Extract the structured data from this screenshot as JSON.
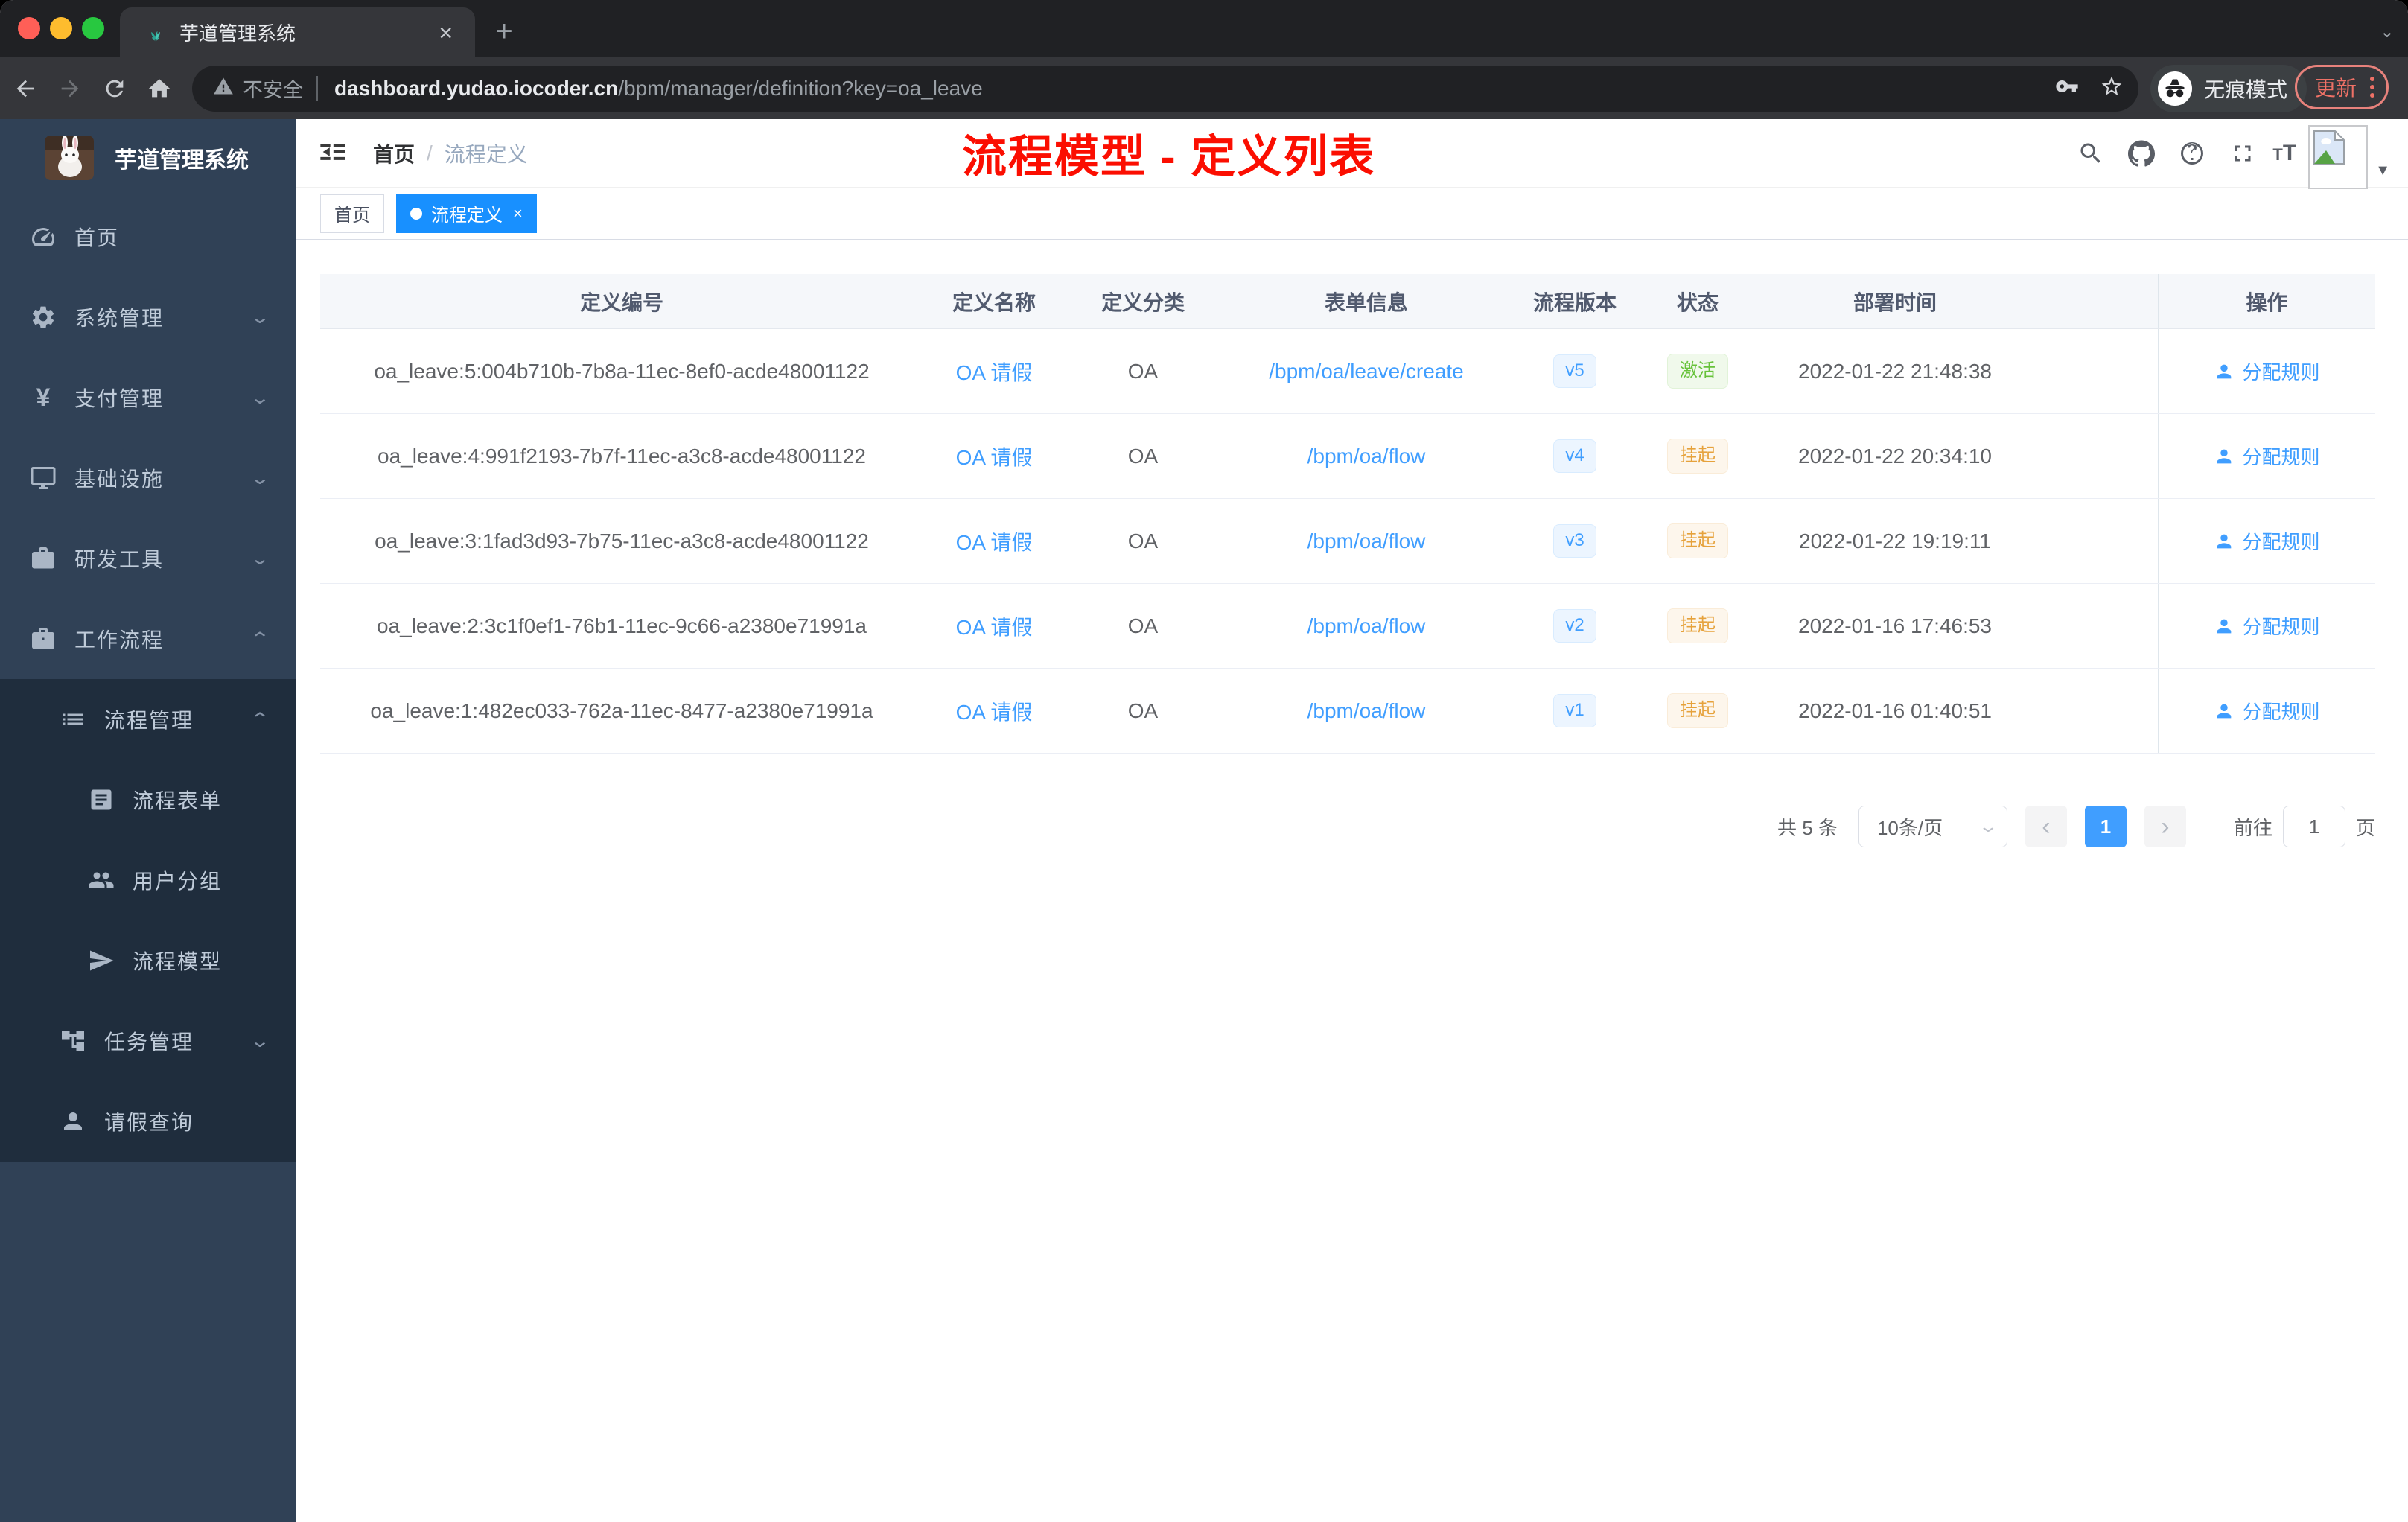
{
  "browser": {
    "tab": {
      "title": "芋道管理系统",
      "favicon": "plant-icon",
      "close": "×"
    },
    "new_tab_label": "+",
    "address": {
      "security_label": "不安全",
      "host": "dashboard.yudao.iocoder.cn",
      "path": "/bpm/manager/definition?key=oa_leave"
    },
    "incognito_label": "无痕模式",
    "update_label": "更新"
  },
  "sidebar": {
    "title": "芋道管理系统",
    "menu": [
      {
        "label": "首页",
        "icon": "gauge-icon",
        "level": 1,
        "arrow": "",
        "dark": false
      },
      {
        "label": "系统管理",
        "icon": "gear-icon",
        "level": 1,
        "arrow": "down",
        "dark": false
      },
      {
        "label": "支付管理",
        "icon": "yen-icon",
        "level": 1,
        "arrow": "down",
        "dark": false
      },
      {
        "label": "基础设施",
        "icon": "monitor-icon",
        "level": 1,
        "arrow": "down",
        "dark": false
      },
      {
        "label": "研发工具",
        "icon": "toolbox-icon",
        "level": 1,
        "arrow": "down",
        "dark": false
      },
      {
        "label": "工作流程",
        "icon": "briefcase-icon",
        "level": 1,
        "arrow": "up",
        "dark": false
      },
      {
        "label": "流程管理",
        "icon": "list-icon",
        "level": 2,
        "arrow": "up",
        "dark": true
      },
      {
        "label": "流程表单",
        "icon": "form-icon",
        "level": 3,
        "arrow": "",
        "dark": true
      },
      {
        "label": "用户分组",
        "icon": "users-icon",
        "level": 3,
        "arrow": "",
        "dark": true
      },
      {
        "label": "流程模型",
        "icon": "send-icon",
        "level": 3,
        "arrow": "",
        "dark": true
      },
      {
        "label": "任务管理",
        "icon": "tree-icon",
        "level": 2,
        "arrow": "down",
        "dark": true
      },
      {
        "label": "请假查询",
        "icon": "person-icon",
        "level": 2,
        "arrow": "",
        "dark": true
      }
    ]
  },
  "navbar": {
    "breadcrumb_home": "首页",
    "breadcrumb_separator": "/",
    "breadcrumb_current": "流程定义",
    "annotation": "流程模型 - 定义列表"
  },
  "tags": [
    {
      "label": "首页",
      "active": false,
      "closable": false
    },
    {
      "label": "流程定义",
      "active": true,
      "closable": true,
      "close": "×"
    }
  ],
  "table": {
    "columns": [
      "定义编号",
      "定义名称",
      "定义分类",
      "表单信息",
      "流程版本",
      "状态",
      "部署时间",
      "操作"
    ],
    "action_label": "分配规则",
    "rows": [
      {
        "id": "oa_leave:5:004b710b-7b8a-11ec-8ef0-acde48001122",
        "name": "OA 请假",
        "category": "OA",
        "form": "/bpm/oa/leave/create",
        "version": "v5",
        "status": "激活",
        "status_type": "success",
        "time": "2022-01-22 21:48:38"
      },
      {
        "id": "oa_leave:4:991f2193-7b7f-11ec-a3c8-acde48001122",
        "name": "OA 请假",
        "category": "OA",
        "form": "/bpm/oa/flow",
        "version": "v4",
        "status": "挂起",
        "status_type": "warning",
        "time": "2022-01-22 20:34:10"
      },
      {
        "id": "oa_leave:3:1fad3d93-7b75-11ec-a3c8-acde48001122",
        "name": "OA 请假",
        "category": "OA",
        "form": "/bpm/oa/flow",
        "version": "v3",
        "status": "挂起",
        "status_type": "warning",
        "time": "2022-01-22 19:19:11"
      },
      {
        "id": "oa_leave:2:3c1f0ef1-76b1-11ec-9c66-a2380e71991a",
        "name": "OA 请假",
        "category": "OA",
        "form": "/bpm/oa/flow",
        "version": "v2",
        "status": "挂起",
        "status_type": "warning",
        "time": "2022-01-16 17:46:53"
      },
      {
        "id": "oa_leave:1:482ec033-762a-11ec-8477-a2380e71991a",
        "name": "OA 请假",
        "category": "OA",
        "form": "/bpm/oa/flow",
        "version": "v1",
        "status": "挂起",
        "status_type": "warning",
        "time": "2022-01-16 01:40:51"
      }
    ]
  },
  "pagination": {
    "total_label": "共 5 条",
    "page_size_label": "10条/页",
    "prev": "‹",
    "current_page": "1",
    "next": "›",
    "goto_label": "前往",
    "goto_value": "1",
    "unit_label": "页"
  },
  "colors": {
    "accent": "#409EFF",
    "tag_active": "#1890ff",
    "success": "#67C23A",
    "warning": "#E6A23C",
    "annotation_red": "#fb0e01",
    "sidebar_bg": "#304156",
    "submenu_bg": "#1f2d3d"
  }
}
